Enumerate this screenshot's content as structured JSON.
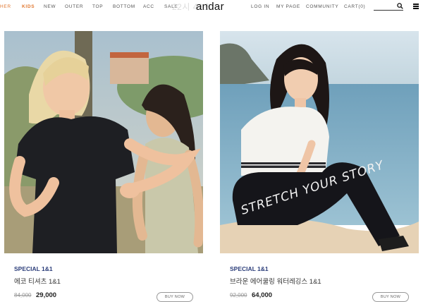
{
  "header": {
    "nav_items": [
      {
        "label": "HER",
        "style": "cut"
      },
      {
        "label": "KIDS",
        "style": "kids"
      },
      {
        "label": "NEW",
        "style": "normal"
      },
      {
        "label": "OUTER",
        "style": "normal"
      },
      {
        "label": "TOP",
        "style": "normal"
      },
      {
        "label": "BOTTOM",
        "style": "normal"
      },
      {
        "label": "ACC",
        "style": "normal"
      },
      {
        "label": "SALE",
        "style": "normal"
      }
    ],
    "timer_text": "22시 42초",
    "logo": "andar",
    "user_links": [
      "LOG IN",
      "MY PAGE",
      "COMMUNITY",
      "CART(0)"
    ],
    "search_value": "",
    "icons": {
      "search": "search-icon",
      "menu": "hamburger-menu-icon"
    }
  },
  "products": [
    {
      "label": "SPECIAL 1&1",
      "name": "에코 티셔츠 1&1",
      "old_price": "84,000",
      "price": "29,000",
      "button": "BUY NOW",
      "photo": "two women running outdoors"
    },
    {
      "label": "SPECIAL 1&1",
      "name": "브라운 에어쿨링 워터레깅스 1&1",
      "old_price": "92,000",
      "price": "64,000",
      "button": "BUY NOW",
      "photo": "woman sitting on beach",
      "leggings_text": "STRETCH YOUR STORY"
    }
  ],
  "colors": {
    "accent_kids": "#e0772f",
    "label_blue": "#2c3e7a"
  }
}
